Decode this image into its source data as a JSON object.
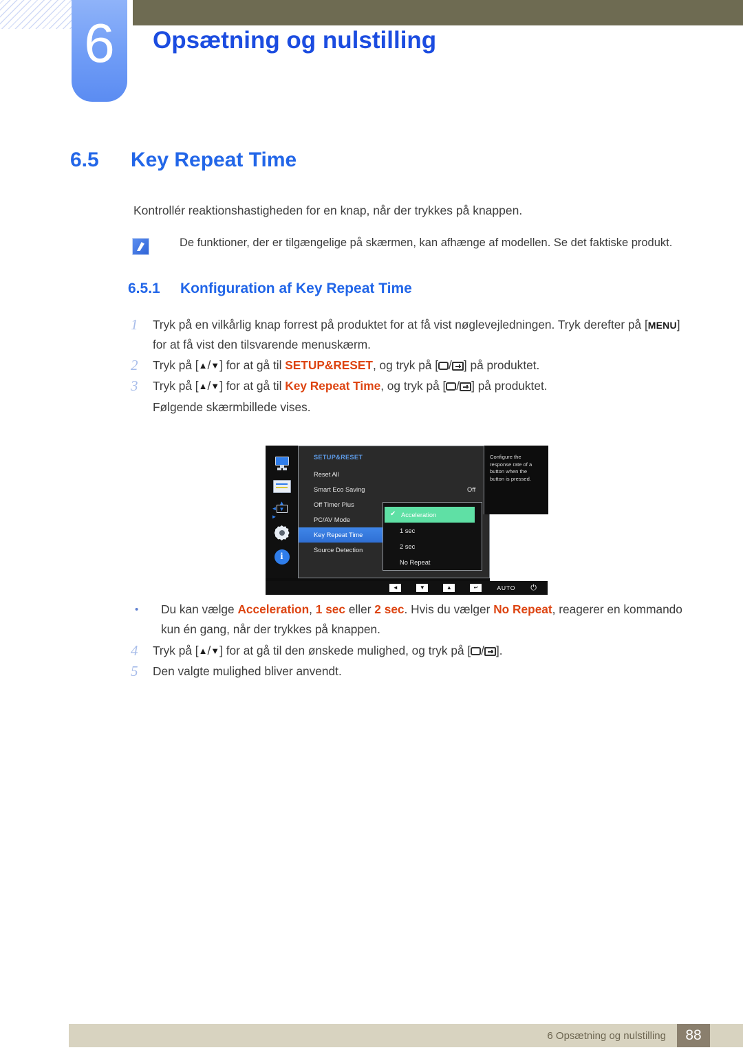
{
  "header": {
    "chapter_number": "6",
    "chapter_title": "Opsætning og nulstilling"
  },
  "section": {
    "number": "6.5",
    "title": "Key Repeat Time",
    "intro": "Kontrollér reaktionshastigheden for en knap, når der trykkes på knappen."
  },
  "note": {
    "icon": "note-pencil-icon",
    "text": "De funktioner, der er tilgængelige på skærmen, kan afhænge af modellen. Se det faktiske produkt."
  },
  "subsection": {
    "number": "6.5.1",
    "title": "Konfiguration af Key Repeat Time"
  },
  "steps": [
    {
      "num": "1",
      "parts": [
        {
          "t": "Tryk på en vilkårlig knap forrest på produktet for at få vist nøglevejledningen. Tryk derefter på ["
        },
        {
          "t": "MENU",
          "style": "key"
        },
        {
          "t": "] for at få vist den tilsvarende menuskærm."
        }
      ]
    },
    {
      "num": "2",
      "parts": [
        {
          "t": "Tryk på ["
        },
        {
          "t": "▲",
          "style": "tri"
        },
        {
          "t": "/"
        },
        {
          "t": "▼",
          "style": "tri"
        },
        {
          "t": "] for at gå til "
        },
        {
          "t": "SETUP&RESET",
          "style": "hl"
        },
        {
          "t": ", og tryk på ["
        },
        {
          "t": "",
          "style": "icon-rect"
        },
        {
          "t": "/"
        },
        {
          "t": "",
          "style": "icon-enter"
        },
        {
          "t": "] på produktet."
        }
      ]
    },
    {
      "num": "3",
      "parts": [
        {
          "t": "Tryk på ["
        },
        {
          "t": "▲",
          "style": "tri"
        },
        {
          "t": "/"
        },
        {
          "t": "▼",
          "style": "tri"
        },
        {
          "t": "] for at gå til "
        },
        {
          "t": "Key Repeat Time",
          "style": "hl"
        },
        {
          "t": ", og tryk på ["
        },
        {
          "t": "",
          "style": "icon-rect"
        },
        {
          "t": "/"
        },
        {
          "t": "",
          "style": "icon-enter"
        },
        {
          "t": "] på produktet."
        }
      ],
      "subline": "Følgende skærmbillede vises."
    }
  ],
  "steps_after": [
    {
      "num": "4",
      "parts": [
        {
          "t": "Tryk på ["
        },
        {
          "t": "▲",
          "style": "tri"
        },
        {
          "t": "/"
        },
        {
          "t": "▼",
          "style": "tri"
        },
        {
          "t": "] for at gå til den ønskede mulighed, og tryk på ["
        },
        {
          "t": "",
          "style": "icon-rect"
        },
        {
          "t": "/"
        },
        {
          "t": "",
          "style": "icon-enter"
        },
        {
          "t": "]."
        }
      ]
    },
    {
      "num": "5",
      "parts": [
        {
          "t": "Den valgte mulighed bliver anvendt."
        }
      ]
    }
  ],
  "bullet": {
    "marker": "•",
    "parts": [
      {
        "t": "Du kan vælge "
      },
      {
        "t": "Acceleration",
        "style": "hl"
      },
      {
        "t": ", "
      },
      {
        "t": "1 sec",
        "style": "hl"
      },
      {
        "t": " eller "
      },
      {
        "t": "2 sec",
        "style": "hl"
      },
      {
        "t": ". Hvis du vælger "
      },
      {
        "t": "No Repeat",
        "style": "hl"
      },
      {
        "t": ", reagerer en kommando kun én gang, når der trykkes på knappen."
      }
    ]
  },
  "osd": {
    "title": "SETUP&RESET",
    "sidebar_icons": [
      "monitor-icon",
      "picture-sliders-icon",
      "screen-adjust-icon",
      "gear-icon",
      "info-icon"
    ],
    "selected_sidebar_index": 3,
    "menu_items": [
      {
        "label": "Reset All",
        "value": "",
        "selected": false
      },
      {
        "label": "Smart Eco Saving",
        "value": "Off",
        "selected": false
      },
      {
        "label": "Off Timer Plus",
        "value": "",
        "selected": false
      },
      {
        "label": "PC/AV Mode",
        "value": "",
        "selected": false
      },
      {
        "label": "Key Repeat Time",
        "value": "",
        "selected": true
      },
      {
        "label": "Source Detection",
        "value": "",
        "selected": false
      }
    ],
    "submenu_options": [
      {
        "label": "Acceleration",
        "checked": true
      },
      {
        "label": "1 sec",
        "checked": false
      },
      {
        "label": "2 sec",
        "checked": false
      },
      {
        "label": "No Repeat",
        "checked": false
      }
    ],
    "description": "Configure the response rate of a button when the button is pressed.",
    "bottom_bar": {
      "keys": [
        "◄",
        "▼",
        "▲",
        "↵"
      ],
      "auto_label": "AUTO",
      "power_icon": "⏻"
    },
    "colors": {
      "selected_menu": "#3f86e8",
      "selected_option": "#5fe0a5",
      "title_text": "#5d9be8"
    }
  },
  "footer": {
    "text": "6 Opsætning og nulstilling",
    "page": "88"
  }
}
